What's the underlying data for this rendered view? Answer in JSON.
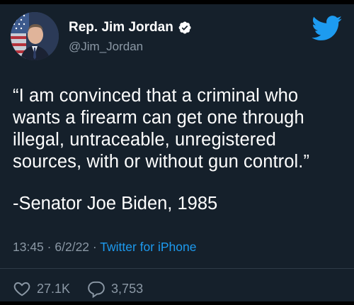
{
  "author": {
    "display_name": "Rep. Jim Jordan",
    "handle": "@Jim_Jordan",
    "verified": true,
    "avatar": "profile-photo"
  },
  "tweet": {
    "lines": [
      "“I am convinced that a criminal who",
      "wants a firearm can get one through",
      "illegal, untraceable, unregistered",
      "sources, with or without gun control.”"
    ],
    "attribution": "-Senator Joe Biden, 1985"
  },
  "meta": {
    "time": "13:45",
    "separator": "·",
    "date": "6/2/22",
    "source": "Twitter for iPhone"
  },
  "stats": {
    "likes": "27.1K",
    "replies": "3,753"
  },
  "colors": {
    "background": "#15202b",
    "text": "#ffffff",
    "secondary": "#8b98a5",
    "accent": "#1d9bf0"
  },
  "icons": {
    "brand": "twitter-bird-icon",
    "verified": "verified-badge-icon",
    "like": "heart-icon",
    "reply": "reply-bubble-icon"
  }
}
